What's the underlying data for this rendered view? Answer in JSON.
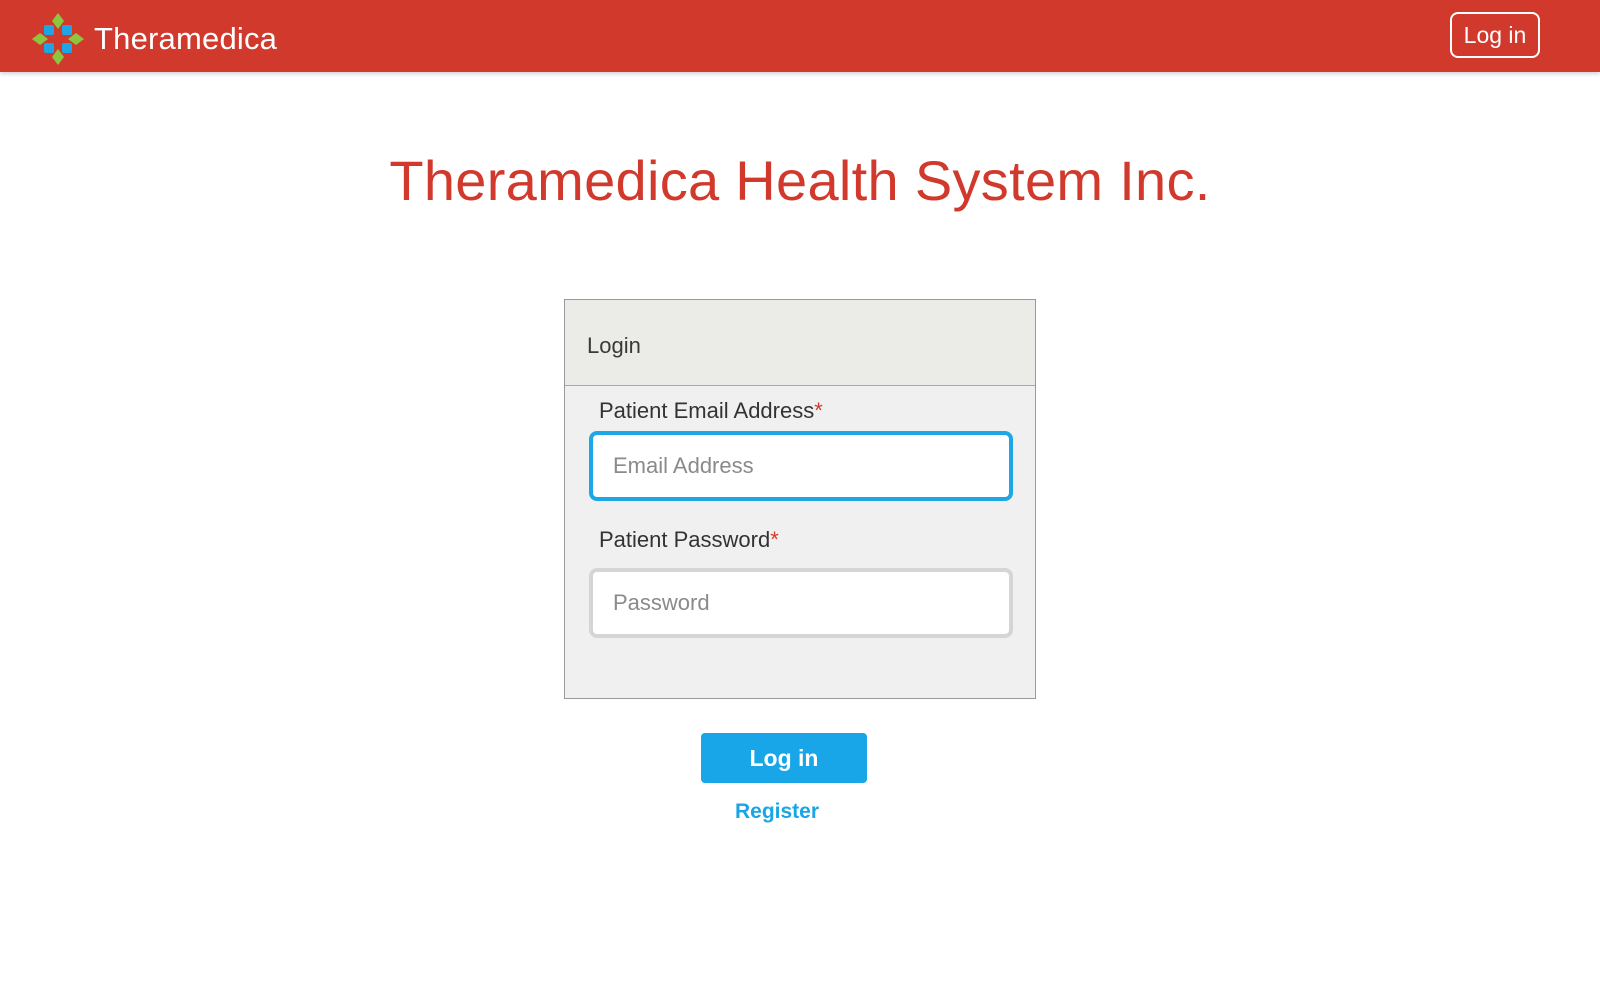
{
  "header": {
    "brand_name": "Theramedica",
    "login_button": "Log in",
    "logo_icon": "theramedica-logo-icon",
    "colors": {
      "brand_red": "#d2392d",
      "logo_green": "#8cc63f",
      "logo_blue": "#1ea6e4"
    }
  },
  "page": {
    "title": "Theramedica Health System Inc."
  },
  "login_card": {
    "header": "Login",
    "email": {
      "label": "Patient Email Address",
      "required_marker": "*",
      "placeholder": "Email Address",
      "value": ""
    },
    "password": {
      "label": "Patient Password",
      "required_marker": "*",
      "placeholder": "Password",
      "value": ""
    }
  },
  "actions": {
    "submit_label": "Log in",
    "register_label": "Register",
    "accent_color": "#18a6e8"
  }
}
